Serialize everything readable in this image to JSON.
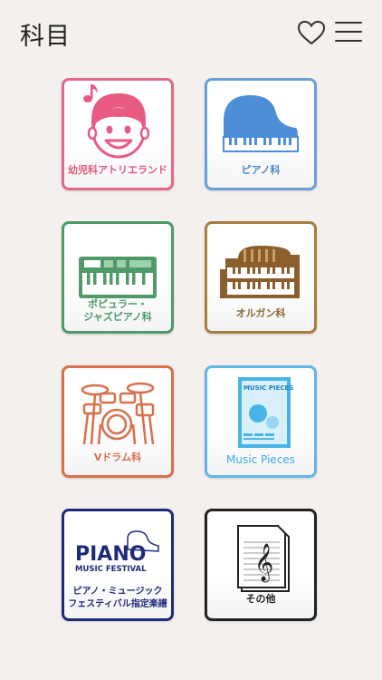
{
  "header": {
    "title": "科目",
    "favorite_icon": "heart-outline-icon",
    "menu_icon": "hamburger-menu-icon"
  },
  "tiles": [
    {
      "label": "幼児科アトリエランド",
      "icon": "smiling-child-with-music-note",
      "color": "#e26a86"
    },
    {
      "label": "ピアノ科",
      "icon": "grand-piano",
      "color": "#6a9fd8"
    },
    {
      "label_lines": [
        "ポピュラー・",
        "ジャズピアノ科"
      ],
      "icon": "electronic-keyboard",
      "color": "#4f9a68"
    },
    {
      "label": "オルガン科",
      "icon": "organ",
      "color": "#a87e3f"
    },
    {
      "label": "Vドラム科",
      "icon": "drum-kit",
      "color": "#d8704c"
    },
    {
      "label": "Music Pieces",
      "icon": "music-pieces-cover",
      "color": "#62b6e8",
      "cover_title": "MUSIC PIECES"
    },
    {
      "label_lines": [
        "ピアノ・ミュージック",
        "フェスティバル指定楽譜"
      ],
      "icon": "piano-music-festival-logo",
      "color": "#1f2b7a",
      "logo_text": [
        "PIANO",
        "MUSIC FESTIVAL"
      ]
    },
    {
      "label": "その他",
      "icon": "sheet-music-treble-clef",
      "color": "#222222"
    }
  ]
}
